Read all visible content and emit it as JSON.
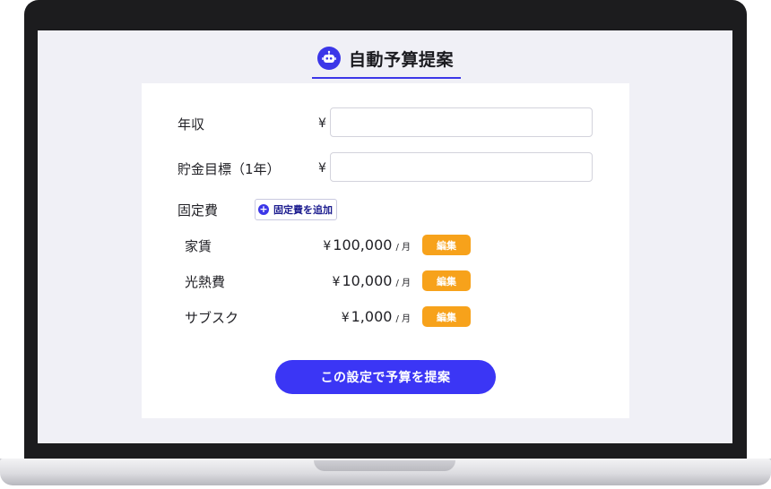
{
  "header": {
    "title": "自動予算提案",
    "icon": "robot-icon"
  },
  "form": {
    "income": {
      "label": "年収",
      "currency": "¥",
      "value": ""
    },
    "savings_goal": {
      "label": "貯金目標（1年）",
      "currency": "¥",
      "value": ""
    },
    "fixed_costs": {
      "label": "固定費",
      "add_button_label": "固定費を追加",
      "items": [
        {
          "name": "家賃",
          "currency": "¥",
          "amount": "100,000",
          "unit": "/ 月",
          "edit_label": "編集"
        },
        {
          "name": "光熱費",
          "currency": "¥",
          "amount": "10,000",
          "unit": "/ 月",
          "edit_label": "編集"
        },
        {
          "name": "サブスク",
          "currency": "¥",
          "amount": "1,000",
          "unit": "/ 月",
          "edit_label": "編集"
        }
      ]
    },
    "submit_label": "この設定で予算を提案"
  },
  "colors": {
    "accent": "#3b36e8",
    "button_primary": "#3b36f5",
    "edit_button": "#f7a21b",
    "screen_background": "#f0f0f6"
  }
}
